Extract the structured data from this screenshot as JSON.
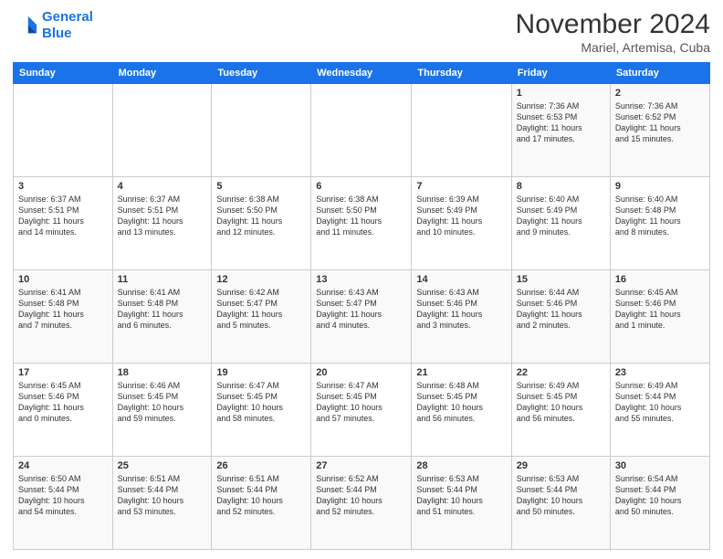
{
  "header": {
    "logo_line1": "General",
    "logo_line2": "Blue",
    "month_title": "November 2024",
    "location": "Mariel, Artemisa, Cuba"
  },
  "weekdays": [
    "Sunday",
    "Monday",
    "Tuesday",
    "Wednesday",
    "Thursday",
    "Friday",
    "Saturday"
  ],
  "weeks": [
    [
      {
        "day": "",
        "info": ""
      },
      {
        "day": "",
        "info": ""
      },
      {
        "day": "",
        "info": ""
      },
      {
        "day": "",
        "info": ""
      },
      {
        "day": "",
        "info": ""
      },
      {
        "day": "1",
        "info": "Sunrise: 7:36 AM\nSunset: 6:53 PM\nDaylight: 11 hours\nand 17 minutes."
      },
      {
        "day": "2",
        "info": "Sunrise: 7:36 AM\nSunset: 6:52 PM\nDaylight: 11 hours\nand 15 minutes."
      }
    ],
    [
      {
        "day": "3",
        "info": "Sunrise: 6:37 AM\nSunset: 5:51 PM\nDaylight: 11 hours\nand 14 minutes."
      },
      {
        "day": "4",
        "info": "Sunrise: 6:37 AM\nSunset: 5:51 PM\nDaylight: 11 hours\nand 13 minutes."
      },
      {
        "day": "5",
        "info": "Sunrise: 6:38 AM\nSunset: 5:50 PM\nDaylight: 11 hours\nand 12 minutes."
      },
      {
        "day": "6",
        "info": "Sunrise: 6:38 AM\nSunset: 5:50 PM\nDaylight: 11 hours\nand 11 minutes."
      },
      {
        "day": "7",
        "info": "Sunrise: 6:39 AM\nSunset: 5:49 PM\nDaylight: 11 hours\nand 10 minutes."
      },
      {
        "day": "8",
        "info": "Sunrise: 6:40 AM\nSunset: 5:49 PM\nDaylight: 11 hours\nand 9 minutes."
      },
      {
        "day": "9",
        "info": "Sunrise: 6:40 AM\nSunset: 5:48 PM\nDaylight: 11 hours\nand 8 minutes."
      }
    ],
    [
      {
        "day": "10",
        "info": "Sunrise: 6:41 AM\nSunset: 5:48 PM\nDaylight: 11 hours\nand 7 minutes."
      },
      {
        "day": "11",
        "info": "Sunrise: 6:41 AM\nSunset: 5:48 PM\nDaylight: 11 hours\nand 6 minutes."
      },
      {
        "day": "12",
        "info": "Sunrise: 6:42 AM\nSunset: 5:47 PM\nDaylight: 11 hours\nand 5 minutes."
      },
      {
        "day": "13",
        "info": "Sunrise: 6:43 AM\nSunset: 5:47 PM\nDaylight: 11 hours\nand 4 minutes."
      },
      {
        "day": "14",
        "info": "Sunrise: 6:43 AM\nSunset: 5:46 PM\nDaylight: 11 hours\nand 3 minutes."
      },
      {
        "day": "15",
        "info": "Sunrise: 6:44 AM\nSunset: 5:46 PM\nDaylight: 11 hours\nand 2 minutes."
      },
      {
        "day": "16",
        "info": "Sunrise: 6:45 AM\nSunset: 5:46 PM\nDaylight: 11 hours\nand 1 minute."
      }
    ],
    [
      {
        "day": "17",
        "info": "Sunrise: 6:45 AM\nSunset: 5:46 PM\nDaylight: 11 hours\nand 0 minutes."
      },
      {
        "day": "18",
        "info": "Sunrise: 6:46 AM\nSunset: 5:45 PM\nDaylight: 10 hours\nand 59 minutes."
      },
      {
        "day": "19",
        "info": "Sunrise: 6:47 AM\nSunset: 5:45 PM\nDaylight: 10 hours\nand 58 minutes."
      },
      {
        "day": "20",
        "info": "Sunrise: 6:47 AM\nSunset: 5:45 PM\nDaylight: 10 hours\nand 57 minutes."
      },
      {
        "day": "21",
        "info": "Sunrise: 6:48 AM\nSunset: 5:45 PM\nDaylight: 10 hours\nand 56 minutes."
      },
      {
        "day": "22",
        "info": "Sunrise: 6:49 AM\nSunset: 5:45 PM\nDaylight: 10 hours\nand 56 minutes."
      },
      {
        "day": "23",
        "info": "Sunrise: 6:49 AM\nSunset: 5:44 PM\nDaylight: 10 hours\nand 55 minutes."
      }
    ],
    [
      {
        "day": "24",
        "info": "Sunrise: 6:50 AM\nSunset: 5:44 PM\nDaylight: 10 hours\nand 54 minutes."
      },
      {
        "day": "25",
        "info": "Sunrise: 6:51 AM\nSunset: 5:44 PM\nDaylight: 10 hours\nand 53 minutes."
      },
      {
        "day": "26",
        "info": "Sunrise: 6:51 AM\nSunset: 5:44 PM\nDaylight: 10 hours\nand 52 minutes."
      },
      {
        "day": "27",
        "info": "Sunrise: 6:52 AM\nSunset: 5:44 PM\nDaylight: 10 hours\nand 52 minutes."
      },
      {
        "day": "28",
        "info": "Sunrise: 6:53 AM\nSunset: 5:44 PM\nDaylight: 10 hours\nand 51 minutes."
      },
      {
        "day": "29",
        "info": "Sunrise: 6:53 AM\nSunset: 5:44 PM\nDaylight: 10 hours\nand 50 minutes."
      },
      {
        "day": "30",
        "info": "Sunrise: 6:54 AM\nSunset: 5:44 PM\nDaylight: 10 hours\nand 50 minutes."
      }
    ]
  ]
}
